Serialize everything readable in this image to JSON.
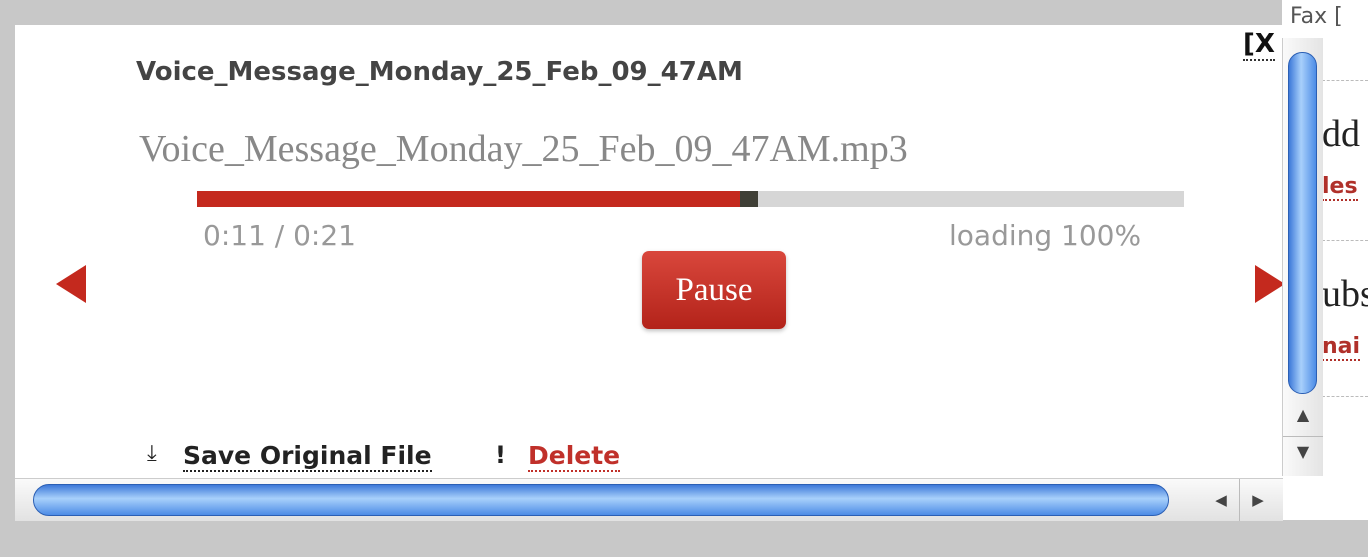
{
  "player": {
    "title": "Voice_Message_Monday_25_Feb_09_47AM",
    "filename": "Voice_Message_Monday_25_Feb_09_47AM.mp3",
    "close_label": "[X",
    "time_readout": "0:11 / 0:21",
    "loading_status": "loading 100%",
    "progress_fraction": 0.55,
    "pause_label": "Pause",
    "accent_color": "#c4291e",
    "icons": {
      "prev": "triangle-left-icon",
      "next": "triangle-right-icon",
      "save": "download-icon",
      "delete": "exclamation-icon"
    }
  },
  "actions": {
    "save_label": "Save Original File",
    "delete_label": "Delete"
  },
  "background_page": {
    "fragments": [
      "Fax [",
      "dd",
      "les",
      "ubs",
      "nai"
    ]
  }
}
